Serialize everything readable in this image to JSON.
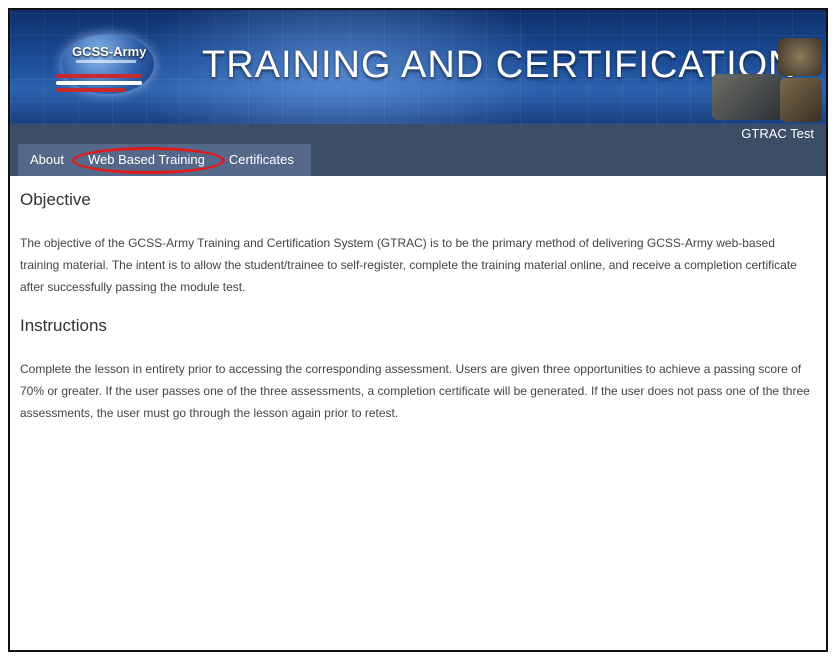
{
  "banner": {
    "logo_text": "GCSS-Army",
    "title": "TRAINING AND CERTIFICATION"
  },
  "header": {
    "user": "GTRAC Test"
  },
  "tabs": [
    {
      "label": "About"
    },
    {
      "label": "Web Based Training",
      "active": true
    },
    {
      "label": "Certificates"
    }
  ],
  "colors": {
    "nav": "#3c4d67",
    "tabs": "#56688a",
    "highlight": "#e01b1b"
  },
  "sections": [
    {
      "heading": "Objective",
      "text": "The objective of the GCSS-Army Training and Certification System (GTRAC) is to be the primary method of delivering GCSS-Army web-based training material. The intent is to allow the student/trainee to self-register, complete the training material online, and receive a completion certificate after successfully passing the module test."
    },
    {
      "heading": "Instructions",
      "text": "Complete the lesson in entirety prior to accessing the corresponding assessment. Users are given three opportunities to achieve a passing score of 70% or greater. If the user passes one of the three assessments, a completion certificate will be generated. If the user does not pass one of the three assessments, the user must go through the lesson again prior to retest."
    }
  ]
}
